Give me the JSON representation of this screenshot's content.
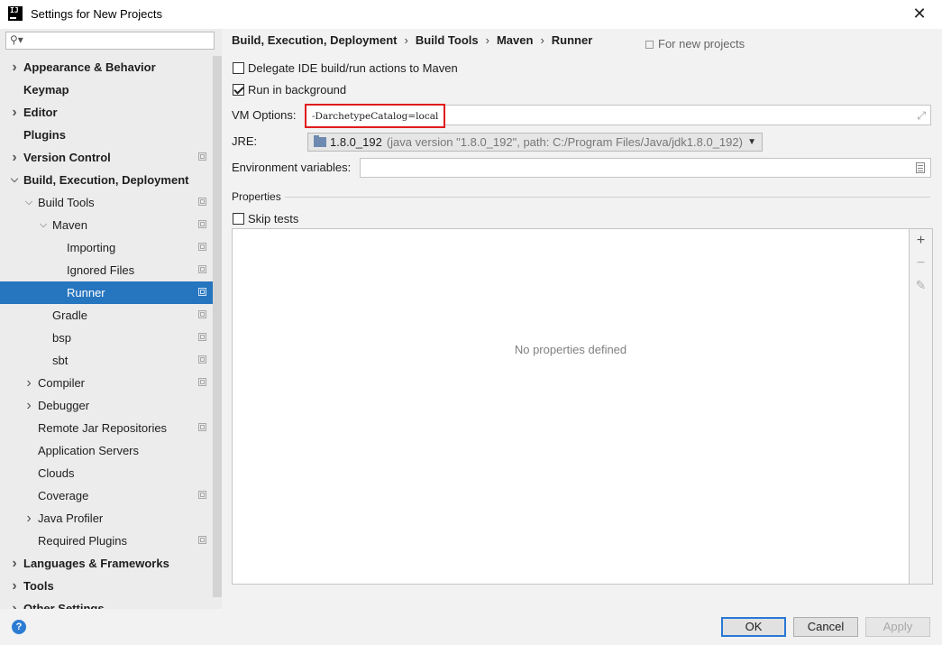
{
  "window": {
    "title": "Settings for New Projects",
    "app_icon_text": "IJ"
  },
  "search": {
    "placeholder": ""
  },
  "sidebar": {
    "items": [
      {
        "label": "Appearance & Behavior",
        "level": 0,
        "expander": "collapsed",
        "bold": true,
        "project_icon": false,
        "selected": false
      },
      {
        "label": "Keymap",
        "level": 0,
        "expander": "none",
        "bold": true,
        "project_icon": false,
        "selected": false
      },
      {
        "label": "Editor",
        "level": 0,
        "expander": "collapsed",
        "bold": true,
        "project_icon": false,
        "selected": false
      },
      {
        "label": "Plugins",
        "level": 0,
        "expander": "none",
        "bold": true,
        "project_icon": false,
        "selected": false
      },
      {
        "label": "Version Control",
        "level": 0,
        "expander": "collapsed",
        "bold": true,
        "project_icon": true,
        "selected": false
      },
      {
        "label": "Build, Execution, Deployment",
        "level": 0,
        "expander": "expanded",
        "bold": true,
        "project_icon": false,
        "selected": false
      },
      {
        "label": "Build Tools",
        "level": 1,
        "expander": "expanded",
        "bold": false,
        "project_icon": true,
        "selected": false
      },
      {
        "label": "Maven",
        "level": 2,
        "expander": "expanded",
        "bold": false,
        "project_icon": true,
        "selected": false
      },
      {
        "label": "Importing",
        "level": 3,
        "expander": "none",
        "bold": false,
        "project_icon": true,
        "selected": false
      },
      {
        "label": "Ignored Files",
        "level": 3,
        "expander": "none",
        "bold": false,
        "project_icon": true,
        "selected": false
      },
      {
        "label": "Runner",
        "level": 3,
        "expander": "none",
        "bold": false,
        "project_icon": true,
        "selected": true
      },
      {
        "label": "Gradle",
        "level": 2,
        "expander": "none",
        "bold": false,
        "project_icon": true,
        "selected": false
      },
      {
        "label": "bsp",
        "level": 2,
        "expander": "none",
        "bold": false,
        "project_icon": true,
        "selected": false
      },
      {
        "label": "sbt",
        "level": 2,
        "expander": "none",
        "bold": false,
        "project_icon": true,
        "selected": false
      },
      {
        "label": "Compiler",
        "level": 1,
        "expander": "collapsed",
        "bold": false,
        "project_icon": true,
        "selected": false
      },
      {
        "label": "Debugger",
        "level": 1,
        "expander": "collapsed",
        "bold": false,
        "project_icon": false,
        "selected": false
      },
      {
        "label": "Remote Jar Repositories",
        "level": 1,
        "expander": "none",
        "bold": false,
        "project_icon": true,
        "selected": false
      },
      {
        "label": "Application Servers",
        "level": 1,
        "expander": "none",
        "bold": false,
        "project_icon": false,
        "selected": false
      },
      {
        "label": "Clouds",
        "level": 1,
        "expander": "none",
        "bold": false,
        "project_icon": false,
        "selected": false
      },
      {
        "label": "Coverage",
        "level": 1,
        "expander": "none",
        "bold": false,
        "project_icon": true,
        "selected": false
      },
      {
        "label": "Java Profiler",
        "level": 1,
        "expander": "collapsed",
        "bold": false,
        "project_icon": false,
        "selected": false
      },
      {
        "label": "Required Plugins",
        "level": 1,
        "expander": "none",
        "bold": false,
        "project_icon": true,
        "selected": false
      },
      {
        "label": "Languages & Frameworks",
        "level": 0,
        "expander": "collapsed",
        "bold": true,
        "project_icon": false,
        "selected": false
      },
      {
        "label": "Tools",
        "level": 0,
        "expander": "collapsed",
        "bold": true,
        "project_icon": false,
        "selected": false
      },
      {
        "label": "Other Settings",
        "level": 0,
        "expander": "collapsed",
        "bold": true,
        "project_icon": false,
        "selected": false
      }
    ]
  },
  "breadcrumb": {
    "items": [
      "Build, Execution, Deployment",
      "Build Tools",
      "Maven",
      "Runner"
    ],
    "separator": "›",
    "scope_note": "For new projects"
  },
  "options": {
    "delegate": {
      "label": "Delegate IDE build/run actions to Maven",
      "checked": false
    },
    "run_background": {
      "label": "Run in background",
      "checked": true
    },
    "vm_options": {
      "label": "VM Options:",
      "value": "-DarchetypeCatalog=local"
    },
    "jre": {
      "label": "JRE:",
      "version": "1.8.0_192",
      "detail": "(java version \"1.8.0_192\", path: C:/Program Files/Java/jdk1.8.0_192)"
    },
    "env": {
      "label": "Environment variables:",
      "value": ""
    },
    "properties_section": "Properties",
    "skip_tests": {
      "label": "Skip tests",
      "checked": false
    },
    "properties_empty": "No properties defined"
  },
  "footer": {
    "help": "?",
    "ok": "OK",
    "cancel": "Cancel",
    "apply": "Apply"
  },
  "colors": {
    "selection": "#2675bf",
    "highlight_border": "#e01c1c",
    "default_button_border": "#2a78d6"
  }
}
